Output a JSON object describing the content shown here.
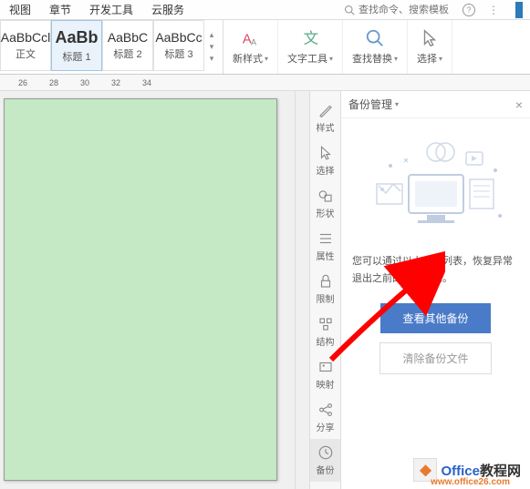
{
  "menu": {
    "items": [
      "视图",
      "章节",
      "开发工具",
      "云服务"
    ],
    "search_placeholder": "查找命令、搜索模板"
  },
  "styles": [
    {
      "preview": "AaBbCcl",
      "label": "正文",
      "bold": false
    },
    {
      "preview": "AaBb",
      "label": "标题 1",
      "bold": true
    },
    {
      "preview": "AaBbC",
      "label": "标题 2",
      "bold": false
    },
    {
      "preview": "AaBbCc",
      "label": "标题 3",
      "bold": false
    }
  ],
  "ribbon": {
    "new_style": "新样式",
    "text_tool": "文字工具",
    "find_replace": "查找替换",
    "select": "选择"
  },
  "ruler": {
    "marks": [
      "26",
      "28",
      "30",
      "32",
      "34"
    ]
  },
  "sidebar": {
    "items": [
      {
        "label": "样式"
      },
      {
        "label": "选择"
      },
      {
        "label": "形状"
      },
      {
        "label": "属性"
      },
      {
        "label": "限制"
      },
      {
        "label": "结构"
      },
      {
        "label": "映射"
      },
      {
        "label": "分享"
      },
      {
        "label": "备份"
      }
    ]
  },
  "panel": {
    "title": "备份管理",
    "description": "您可以通过以上文件列表，恢复异常退出之前的工作状态。",
    "btn_view": "查看其他备份",
    "btn_clear": "清除备份文件"
  },
  "watermark": {
    "brand1": "Office",
    "brand2": "教程网",
    "url": "www.office26.com"
  }
}
